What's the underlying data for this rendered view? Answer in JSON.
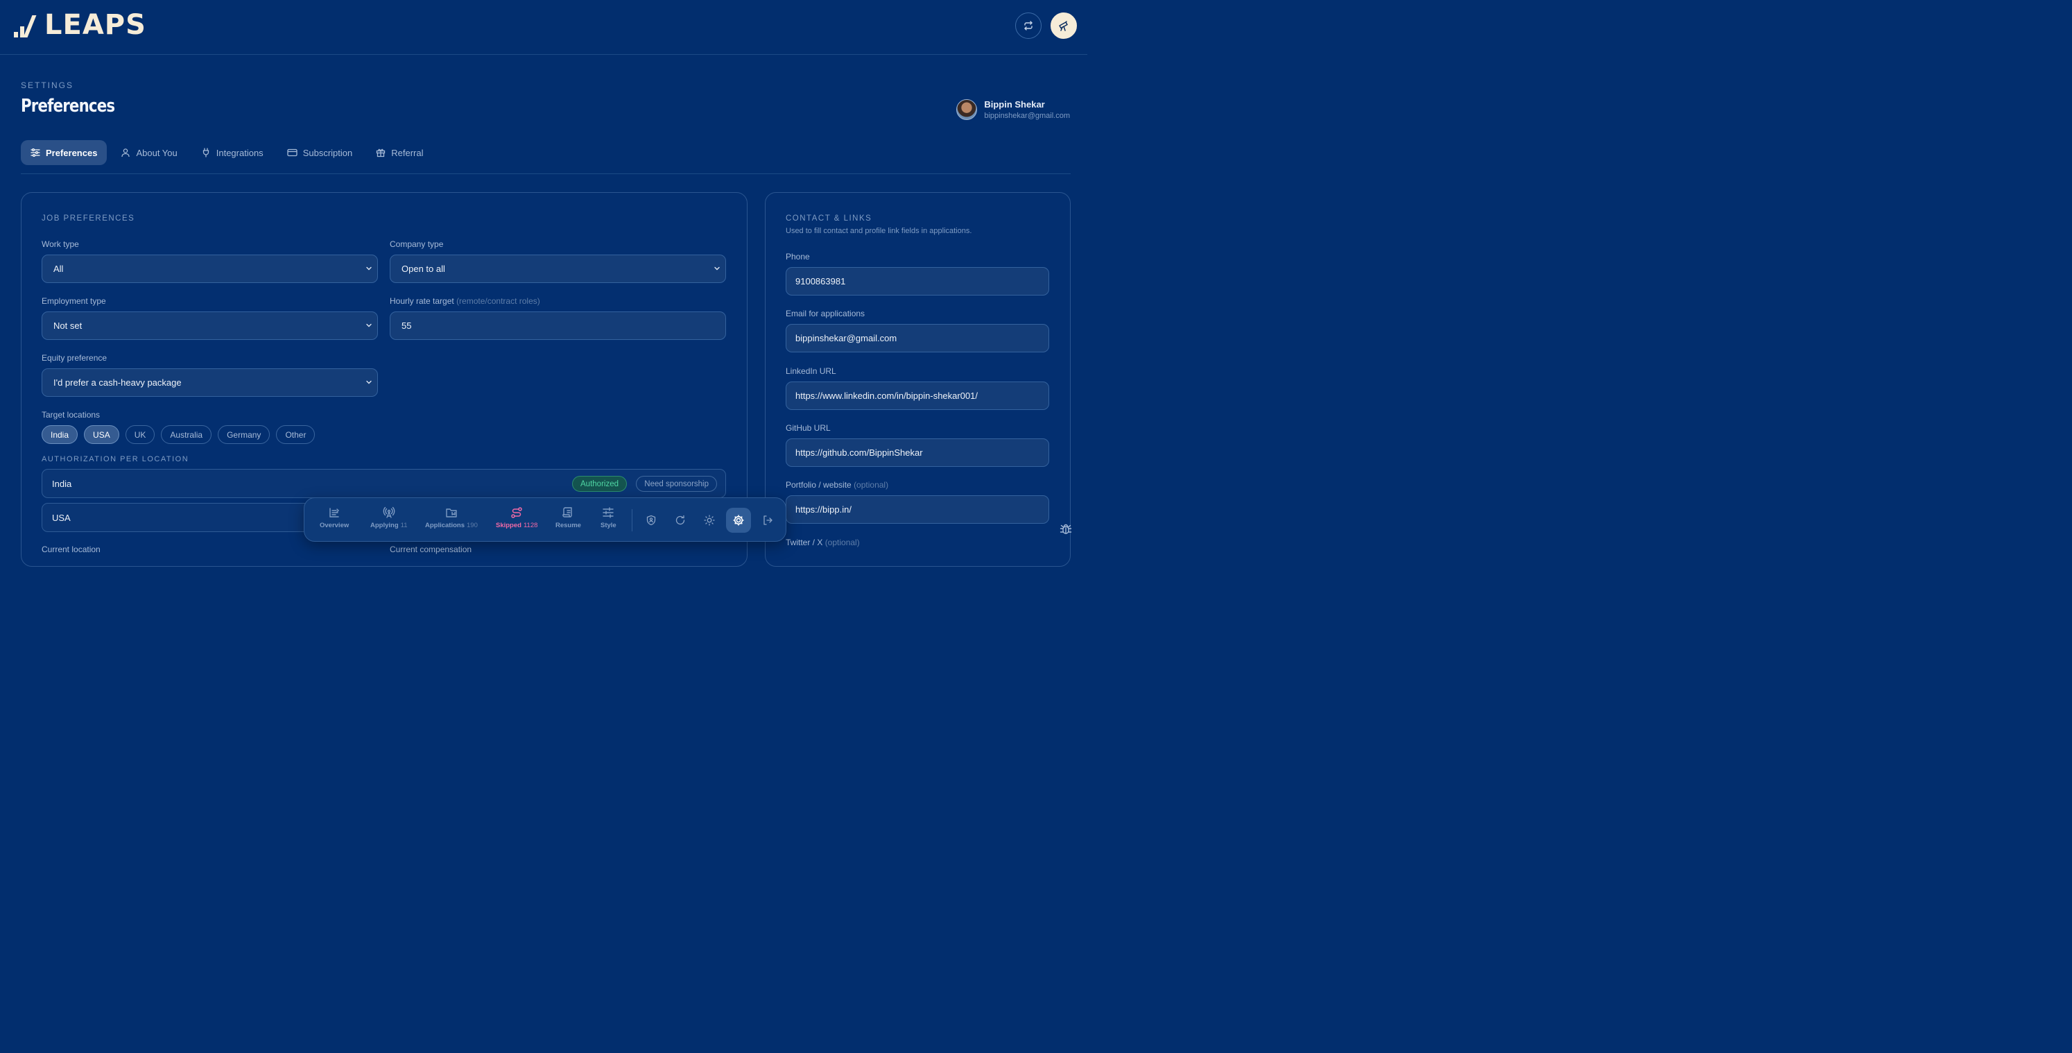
{
  "app": {
    "logo_text": "LEAPS"
  },
  "header": {
    "section_label": "SETTINGS",
    "title": "Preferences"
  },
  "user": {
    "name": "Bippin Shekar",
    "email": "bippinshekar@gmail.com"
  },
  "tabs": [
    {
      "label": "Preferences",
      "icon": "sliders-icon",
      "active": true
    },
    {
      "label": "About You",
      "icon": "user-icon"
    },
    {
      "label": "Integrations",
      "icon": "plug-icon"
    },
    {
      "label": "Subscription",
      "icon": "credit-card-icon"
    },
    {
      "label": "Referral",
      "icon": "gift-icon"
    }
  ],
  "job": {
    "section_label": "JOB PREFERENCES",
    "work_type": {
      "label": "Work type",
      "value": "All"
    },
    "company_type": {
      "label": "Company type",
      "value": "Open to all"
    },
    "employment_type": {
      "label": "Employment type",
      "value": "Not set"
    },
    "hourly_rate": {
      "label": "Hourly rate target",
      "hint": "(remote/contract roles)",
      "value": "55"
    },
    "equity": {
      "label": "Equity preference",
      "value": "I'd prefer a cash-heavy package"
    },
    "target_locations": {
      "label": "Target locations",
      "chips": [
        {
          "label": "India",
          "selected": true
        },
        {
          "label": "USA",
          "selected": true
        },
        {
          "label": "UK",
          "selected": false
        },
        {
          "label": "Australia",
          "selected": false
        },
        {
          "label": "Germany",
          "selected": false
        },
        {
          "label": "Other",
          "selected": false
        }
      ]
    },
    "authorization": {
      "label": "AUTHORIZATION PER LOCATION",
      "rows": [
        {
          "location": "India",
          "authorized": "Authorized",
          "sponsorship": "Need sponsorship"
        },
        {
          "location": "USA"
        }
      ]
    },
    "current_location": {
      "label": "Current location"
    },
    "current_compensation": {
      "label": "Current compensation"
    }
  },
  "contact": {
    "section_label": "CONTACT & LINKS",
    "subtitle": "Used to fill contact and profile link fields in applications.",
    "phone": {
      "label": "Phone",
      "value": "9100863981"
    },
    "email": {
      "label": "Email for applications",
      "value": "bippinshekar@gmail.com"
    },
    "linkedin": {
      "label": "LinkedIn URL",
      "value": "https://www.linkedin.com/in/bippin-shekar001/"
    },
    "github": {
      "label": "GitHub URL",
      "value": "https://github.com/BippinShekar"
    },
    "portfolio": {
      "label": "Portfolio / website",
      "hint": "(optional)",
      "value": "https://bipp.in/"
    },
    "twitter": {
      "label": "Twitter / X",
      "hint": "(optional)"
    }
  },
  "dock": {
    "items": [
      {
        "label": "Overview",
        "count": ""
      },
      {
        "label": "Applying",
        "count": "11"
      },
      {
        "label": "Applications",
        "count": "190"
      },
      {
        "label": "Skipped",
        "count": "1128"
      },
      {
        "label": "Resume",
        "count": ""
      },
      {
        "label": "Style",
        "count": ""
      }
    ]
  },
  "colors": {
    "background": "#022e6e",
    "accent_pink": "#f06aa6",
    "authorized_green": "#4fd6a4",
    "logo_cream": "#f6ecd8"
  }
}
